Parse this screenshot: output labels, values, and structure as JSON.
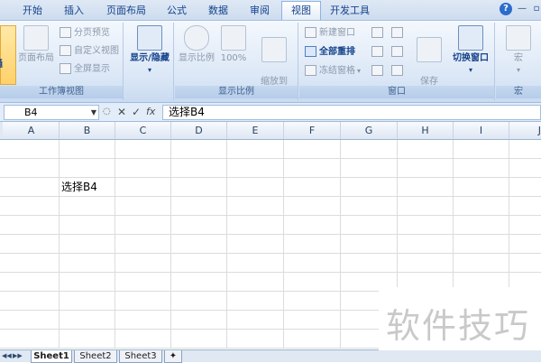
{
  "tabs": [
    "开始",
    "插入",
    "页面布局",
    "公式",
    "数据",
    "审阅",
    "视图",
    "开发工具"
  ],
  "active_tab": "视图",
  "ribbon": {
    "workbook_views": {
      "label": "工作簿视图",
      "normal_btn": "普通",
      "page_layout": "页面布局",
      "page_break_preview": "分页预览",
      "custom_views": "自定义视图",
      "full_screen": "全屏显示"
    },
    "show_hide": {
      "label": "显示/隐藏"
    },
    "zoom": {
      "label": "显示比例",
      "zoom_btn": "显示比例",
      "zoom_100": "100%",
      "zoom_selection": "缩放到\n选定区域"
    },
    "window": {
      "label": "窗口",
      "new_window": "新建窗口",
      "arrange_all": "全部重排",
      "freeze_panes": "冻结窗格",
      "save_workspace": "保存\n工作区",
      "switch_windows": "切换窗口"
    },
    "macros": {
      "label": "宏",
      "macros_btn": "宏"
    }
  },
  "formula_bar": {
    "name_box": "B4",
    "fx_label": "fx",
    "content": "选择B4"
  },
  "columns": [
    "A",
    "B",
    "C",
    "D",
    "E",
    "F",
    "G",
    "H",
    "I",
    "J"
  ],
  "cells": {
    "B4": "选择B4"
  },
  "sheets": [
    "Sheet1",
    "Sheet2",
    "Sheet3"
  ],
  "active_sheet": "Sheet1",
  "watermark": "软件技巧"
}
